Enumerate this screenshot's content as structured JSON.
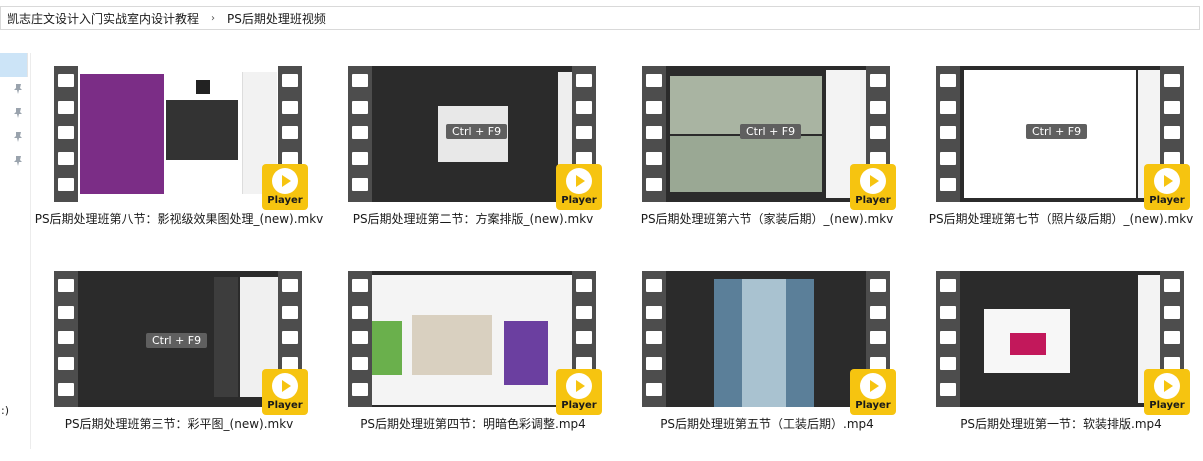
{
  "breadcrumb": {
    "items": [
      "凯志庄文设计入门实战室内设计教程",
      "PS后期处理班视频"
    ],
    "separator": "›"
  },
  "nav": {
    "truncated_label": ":)"
  },
  "files": [
    {
      "name": "PS后期处理班第八节：影视级效果图处理_(new).mkv",
      "badge": "Player"
    },
    {
      "name": "PS后期处理班第二节：方案排版_(new).mkv",
      "badge": "Player",
      "overlay": "Ctrl + F9"
    },
    {
      "name": "PS后期处理班第六节（家装后期）_(new).mkv",
      "badge": "Player",
      "overlay": "Ctrl + F9"
    },
    {
      "name": "PS后期处理班第七节（照片级后期）_(new).mkv",
      "badge": "Player",
      "overlay": "Ctrl + F9"
    },
    {
      "name": "PS后期处理班第三节：彩平图_(new).mkv",
      "badge": "Player",
      "overlay": "Ctrl + F9"
    },
    {
      "name": "PS后期处理班第四节：明暗色彩调整.mp4",
      "badge": "Player"
    },
    {
      "name": "PS后期处理班第五节（工装后期）.mp4",
      "badge": "Player"
    },
    {
      "name": "PS后期处理班第一节：软装排版.mp4",
      "badge": "Player"
    }
  ],
  "colors": {
    "badge": "#f6c410",
    "filmstrip": "#4d4d4d",
    "nav_selected": "#cce4f7"
  },
  "icons": {
    "pin": "pin-icon",
    "chevron": "chevron-right-icon",
    "play": "play-icon"
  }
}
